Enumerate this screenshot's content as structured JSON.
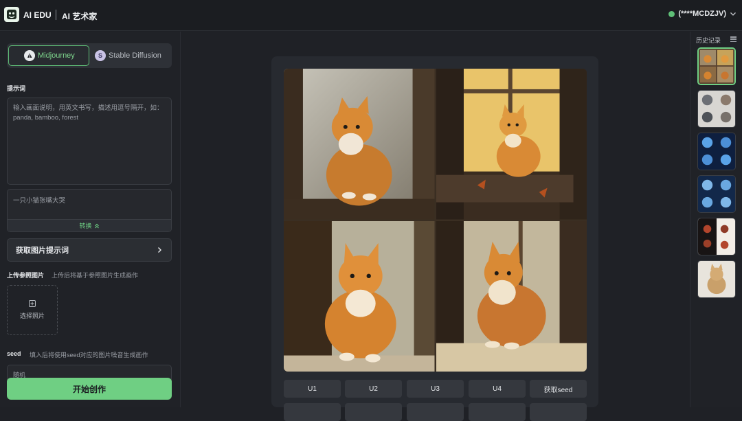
{
  "header": {
    "brand": "AI EDU",
    "app_name": "AI 艺术家",
    "account": "(****MCDZJV)"
  },
  "model_switch": {
    "midjourney_label": "Midjourney",
    "stable_diffusion_label": "Stable Diffusion",
    "selected": "Midjourney"
  },
  "prompt": {
    "section_label": "提示词",
    "placeholder": "输入画面说明，用英文书写，描述用逗号隔开，如：panda, bamboo, forest",
    "translate_text": "一只小猫张嘴大哭",
    "convert_label": "转换"
  },
  "get_prompt_label": "获取图片提示词",
  "upload": {
    "section_label": "上传参照图片",
    "hint": "上传后将基于参照图片生成画作",
    "button_label": "选择照片"
  },
  "seed": {
    "section_label": "seed",
    "hint": "填入后将使用seed对应的图片噪音生成画作",
    "placeholder": "随机"
  },
  "start_label": "开始创作",
  "actions": {
    "u1": "U1",
    "u2": "U2",
    "u3": "U3",
    "u4": "U4",
    "get_seed": "获取seed"
  },
  "history": {
    "title": "历史记录",
    "items": [
      "cats-grid",
      "figures-grid",
      "blue-robots",
      "blue-robots-2",
      "warrior-sheet",
      "cat-statue"
    ]
  },
  "colors": {
    "accent": "#6fcf83",
    "background": "#1f2126",
    "panel": "#202227"
  }
}
